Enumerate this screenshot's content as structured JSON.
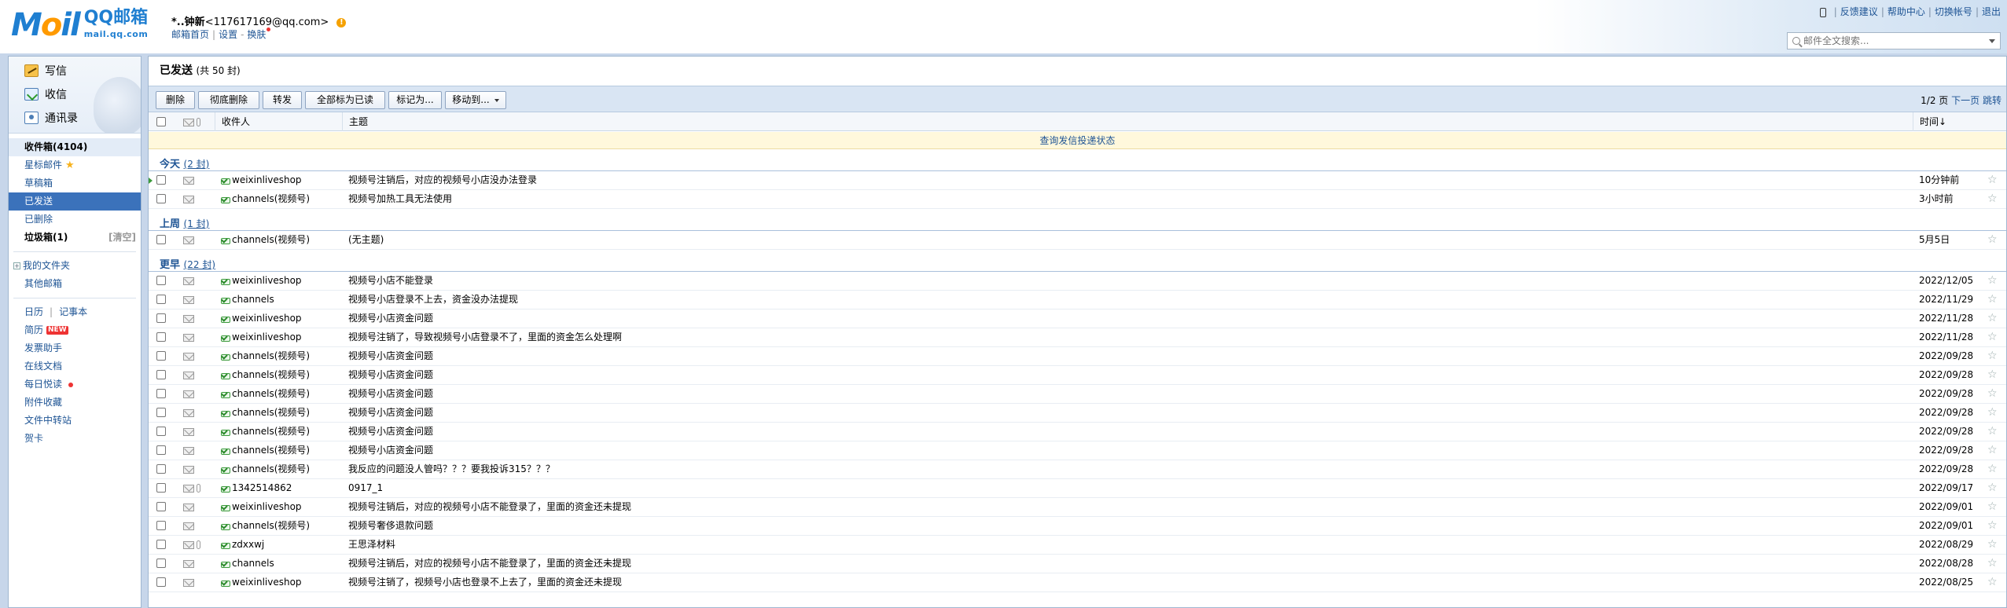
{
  "header": {
    "logo_moil": "M",
    "logo_o": "o",
    "logo_il": "il",
    "logo_qq": "QQ邮箱",
    "logo_url": "mail.qq.com",
    "user_name": "*..钟新",
    "user_email": "<117617169@qq.com>",
    "links": {
      "home": "邮箱首页",
      "settings": "设置",
      "skin": "换肤"
    },
    "top_links": [
      "反馈建议",
      "帮助中心",
      "切换帐号",
      "退出"
    ],
    "search_placeholder": "邮件全文搜索..."
  },
  "sidebar": {
    "compose": "写信",
    "receive": "收信",
    "contacts": "通讯录",
    "folders": {
      "inbox": "收件箱(4104)",
      "starred": "星标邮件",
      "drafts": "草稿箱",
      "sent": "已发送",
      "deleted": "已删除",
      "spam": "垃圾箱(1)",
      "spam_clear": "[清空]"
    },
    "my_folders": "我的文件夹",
    "other_mailboxes": "其他邮箱",
    "apps": {
      "calendar": "日历",
      "notes": "记事本",
      "resume": "简历",
      "resume_badge": "NEW",
      "invoice": "发票助手",
      "docs": "在线文档",
      "daily": "每日悦读",
      "attachments": "附件收藏",
      "file_transfer": "文件中转站",
      "cards": "贺卡"
    }
  },
  "main": {
    "title": "已发送",
    "count": "(共 50 封)",
    "toolbar": {
      "delete": "删除",
      "delete_complete": "彻底删除",
      "forward": "转发",
      "mark_all_read": "全部标为已读",
      "mark_as": "标记为...",
      "move_to": "移动到..."
    },
    "pager": {
      "page": "1/2 页",
      "next": "下一页",
      "jump": "跳转"
    },
    "columns": {
      "recipient": "收件人",
      "subject": "主题",
      "time": "时间↓"
    },
    "status_link": "查询发信投递状态",
    "groups": {
      "today": {
        "title": "今天",
        "count": "(2 封)"
      },
      "last_week": {
        "title": "上周",
        "count": "(1 封)"
      },
      "earlier": {
        "title": "更早",
        "count": "(22 封)"
      }
    },
    "today_rows": [
      {
        "to": "weixinliveshop",
        "subject": "视频号注销后，对应的视频号小店没办法登录",
        "time": "10分钟前"
      },
      {
        "to": "channels(视频号)",
        "subject": "视频号加热工具无法使用",
        "time": "3小时前"
      }
    ],
    "last_week_rows": [
      {
        "to": "channels(视频号)",
        "subject": "(无主题)",
        "time": "5月5日"
      }
    ],
    "earlier_rows": [
      {
        "to": "weixinliveshop",
        "subject": "视频号小店不能登录",
        "time": "2022/12/05"
      },
      {
        "to": "channels",
        "subject": "视频号小店登录不上去，资金没办法提现",
        "time": "2022/11/29"
      },
      {
        "to": "weixinliveshop",
        "subject": "视频号小店资金问题",
        "time": "2022/11/28"
      },
      {
        "to": "weixinliveshop",
        "subject": "视频号注销了，导致视频号小店登录不了，里面的资金怎么处理啊",
        "time": "2022/11/28"
      },
      {
        "to": "channels(视频号)",
        "subject": "视频号小店资金问题",
        "time": "2022/09/28"
      },
      {
        "to": "channels(视频号)",
        "subject": "视频号小店资金问题",
        "time": "2022/09/28"
      },
      {
        "to": "channels(视频号)",
        "subject": "视频号小店资金问题",
        "time": "2022/09/28"
      },
      {
        "to": "channels(视频号)",
        "subject": "视频号小店资金问题",
        "time": "2022/09/28"
      },
      {
        "to": "channels(视频号)",
        "subject": "视频号小店资金问题",
        "time": "2022/09/28"
      },
      {
        "to": "channels(视频号)",
        "subject": "视频号小店资金问题",
        "time": "2022/09/28"
      },
      {
        "to": "channels(视频号)",
        "subject": "我反应的问题没人管吗？？？要我投诉315？？？",
        "time": "2022/09/28"
      },
      {
        "to": "1342514862",
        "subject": "0917_1",
        "time": "2022/09/17"
      },
      {
        "to": "weixinliveshop",
        "subject": "视频号注销后，对应的视频号小店不能登录了，里面的资金还未提现",
        "time": "2022/09/01"
      },
      {
        "to": "channels(视频号)",
        "subject": "视频号奢侈退款问题",
        "time": "2022/09/01"
      },
      {
        "to": "zdxxwj",
        "subject": "王思泽材料",
        "time": "2022/08/29"
      },
      {
        "to": "channels",
        "subject": "视频号注销后，对应的视频号小店不能登录了，里面的资金还未提现",
        "time": "2022/08/28"
      },
      {
        "to": "weixinliveshop",
        "subject": "视频号注销了，视频号小店也登录不上去了，里面的资金还未提现",
        "time": "2022/08/25"
      }
    ]
  }
}
